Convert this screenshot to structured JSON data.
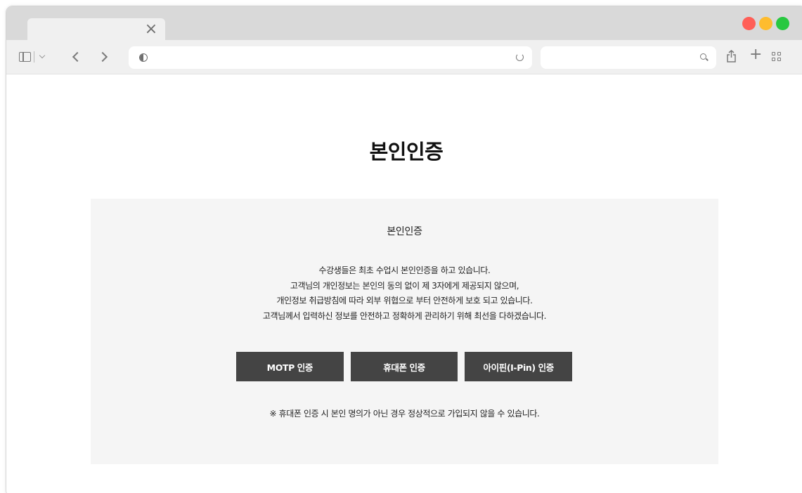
{
  "browser": {
    "tab_close_glyph": "×",
    "traffic_lights": [
      "#ff5f57",
      "#febc2e",
      "#28c840"
    ],
    "new_tab_glyph": "+"
  },
  "page": {
    "title": "본인인증",
    "panel": {
      "heading": "본인인증",
      "description": [
        "수강생들은 최초 수업시 본인인증을 하고 있습니다.",
        "고객님의 개인정보는 본인의 동의 없이 제 3자에게 제공되지 않으며,",
        "개인정보 취급방침에 따라 외부 위협으로 부터 안전하게 보호 되고 있습니다.",
        "고객님께서 입력하신 정보를 안전하고 정확하게 관리하기 위해 최선을 다하겠습니다."
      ],
      "buttons": {
        "motp": "MOTP 인증",
        "phone": "휴대폰 인증",
        "ipin": "아이핀(I-Pin) 인증"
      },
      "notice": "※ 휴대폰 인증 시 본인 명의가 아닌 경우 정상적으로 가입되지 않을 수 있습니다."
    }
  }
}
